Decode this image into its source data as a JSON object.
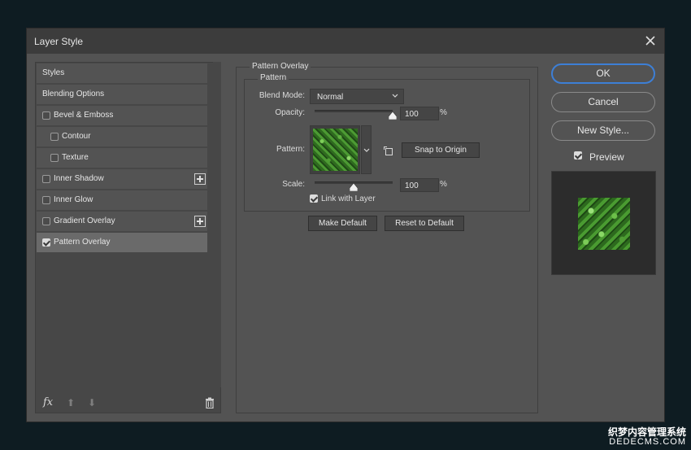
{
  "window": {
    "title": "Layer Style"
  },
  "styles_list": {
    "items": [
      {
        "label": "Styles",
        "checkbox": false,
        "checked": false,
        "indent": false,
        "plus": false,
        "active": false
      },
      {
        "label": "Blending Options",
        "checkbox": false,
        "checked": false,
        "indent": false,
        "plus": false,
        "active": false
      },
      {
        "label": "Bevel & Emboss",
        "checkbox": true,
        "checked": false,
        "indent": false,
        "plus": false,
        "active": false
      },
      {
        "label": "Contour",
        "checkbox": true,
        "checked": false,
        "indent": true,
        "plus": false,
        "active": false
      },
      {
        "label": "Texture",
        "checkbox": true,
        "checked": false,
        "indent": true,
        "plus": false,
        "active": false
      },
      {
        "label": "Inner Shadow",
        "checkbox": true,
        "checked": false,
        "indent": false,
        "plus": true,
        "active": false
      },
      {
        "label": "Inner Glow",
        "checkbox": true,
        "checked": false,
        "indent": false,
        "plus": false,
        "active": false
      },
      {
        "label": "Gradient Overlay",
        "checkbox": true,
        "checked": false,
        "indent": false,
        "plus": true,
        "active": false
      },
      {
        "label": "Pattern Overlay",
        "checkbox": true,
        "checked": true,
        "indent": false,
        "plus": false,
        "active": true
      }
    ],
    "fx_label": "fx"
  },
  "pattern_overlay": {
    "group_title": "Pattern Overlay",
    "subgroup_title": "Pattern",
    "blend_mode_label": "Blend Mode:",
    "blend_mode_value": "Normal",
    "opacity_label": "Opacity:",
    "opacity_value": "100",
    "opacity_level": 1.0,
    "percent": "%",
    "pattern_label": "Pattern:",
    "snap_button": "Snap to Origin",
    "scale_label": "Scale:",
    "scale_value": "100",
    "scale_level": 0.5,
    "link_label": "Link with Layer",
    "link_checked": true,
    "make_default": "Make Default",
    "reset_default": "Reset to Default"
  },
  "actions": {
    "ok": "OK",
    "cancel": "Cancel",
    "new_style": "New Style...",
    "preview_label": "Preview",
    "preview_checked": true
  },
  "watermark": {
    "line1": "织梦内容管理系统",
    "line2": "DEDECMS.COM"
  },
  "colors": {
    "accent": "#3d7fd6",
    "dialog_bg": "#535353",
    "desktop_bg": "#0e1c22"
  }
}
